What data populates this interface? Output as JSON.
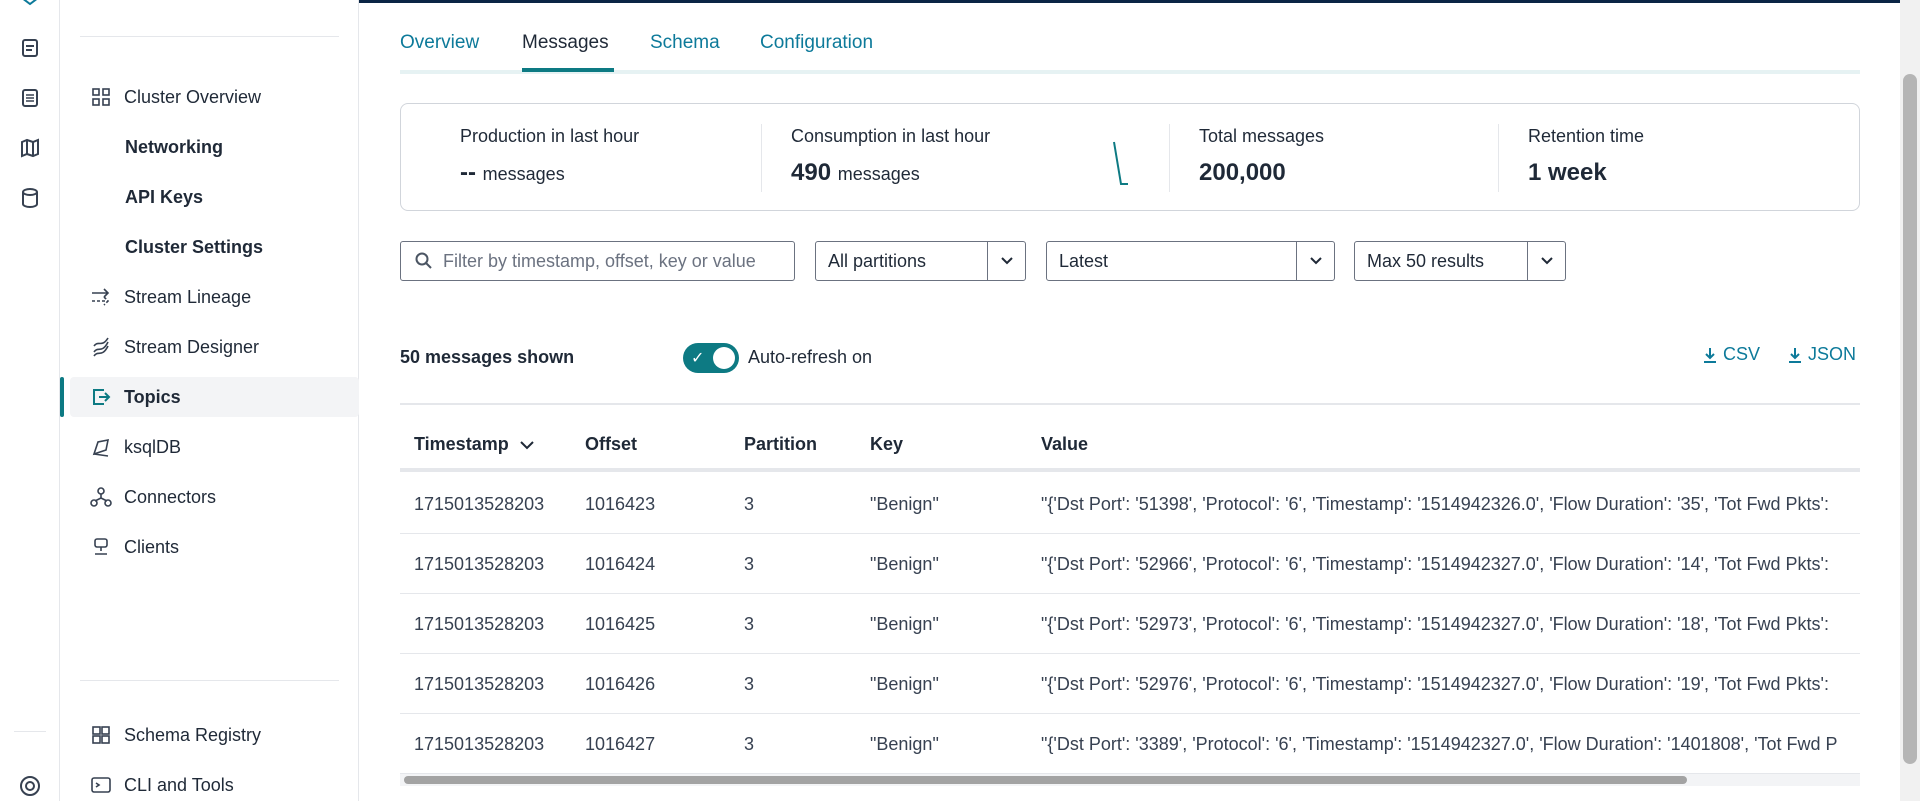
{
  "sidebar": {
    "items": [
      {
        "label": "Cluster Overview"
      },
      {
        "label": "Networking"
      },
      {
        "label": "API Keys"
      },
      {
        "label": "Cluster Settings"
      },
      {
        "label": "Stream Lineage"
      },
      {
        "label": "Stream Designer"
      },
      {
        "label": "Topics"
      },
      {
        "label": "ksqlDB"
      },
      {
        "label": "Connectors"
      },
      {
        "label": "Clients"
      }
    ],
    "bottom_items": [
      {
        "label": "Schema Registry"
      },
      {
        "label": "CLI and Tools"
      }
    ]
  },
  "tabs": [
    {
      "label": "Overview"
    },
    {
      "label": "Messages"
    },
    {
      "label": "Schema"
    },
    {
      "label": "Configuration"
    }
  ],
  "stats": [
    {
      "label": "Production in last hour",
      "value": "--",
      "unit": "messages"
    },
    {
      "label": "Consumption in last hour",
      "value": "490",
      "unit": "messages"
    },
    {
      "label": "Total messages",
      "value": "200,000"
    },
    {
      "label": "Retention time",
      "value": "1 week"
    }
  ],
  "filters": {
    "search_placeholder": "Filter by timestamp, offset, key or value",
    "partitions": "All partitions",
    "offset": "Latest",
    "max_results": "Max 50 results"
  },
  "messages_shown": "50 messages shown",
  "auto_refresh": {
    "label": "Auto-refresh on",
    "on": true
  },
  "downloads": {
    "csv": "CSV",
    "json": "JSON"
  },
  "table": {
    "columns": [
      "Timestamp",
      "Offset",
      "Partition",
      "Key",
      "Value"
    ],
    "rows": [
      {
        "timestamp": "1715013528203",
        "offset": "1016423",
        "partition": "3",
        "key": "\"Benign\"",
        "value": "\"{'Dst Port': '51398', 'Protocol': '6', 'Timestamp': '1514942326.0', 'Flow Duration': '35', 'Tot Fwd Pkts':"
      },
      {
        "timestamp": "1715013528203",
        "offset": "1016424",
        "partition": "3",
        "key": "\"Benign\"",
        "value": "\"{'Dst Port': '52966', 'Protocol': '6', 'Timestamp': '1514942327.0', 'Flow Duration': '14', 'Tot Fwd Pkts':"
      },
      {
        "timestamp": "1715013528203",
        "offset": "1016425",
        "partition": "3",
        "key": "\"Benign\"",
        "value": "\"{'Dst Port': '52973', 'Protocol': '6', 'Timestamp': '1514942327.0', 'Flow Duration': '18', 'Tot Fwd Pkts':"
      },
      {
        "timestamp": "1715013528203",
        "offset": "1016426",
        "partition": "3",
        "key": "\"Benign\"",
        "value": "\"{'Dst Port': '52976', 'Protocol': '6', 'Timestamp': '1514942327.0', 'Flow Duration': '19', 'Tot Fwd Pkts':"
      },
      {
        "timestamp": "1715013528203",
        "offset": "1016427",
        "partition": "3",
        "key": "\"Benign\"",
        "value": "\"{'Dst Port': '3389', 'Protocol': '6', 'Timestamp': '1514942327.0', 'Flow Duration': '1401808', 'Tot Fwd P"
      }
    ]
  },
  "colors": {
    "accent": "#0d7a83",
    "link": "#0d7a9a"
  }
}
